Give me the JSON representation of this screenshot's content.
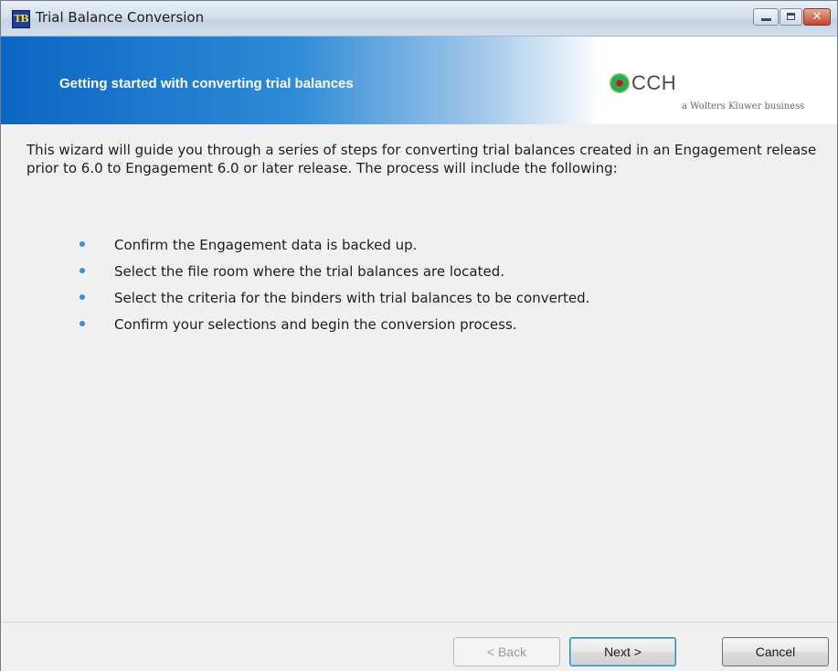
{
  "window": {
    "title": "Trial Balance Conversion",
    "icon": "TB-app-icon"
  },
  "titlebar_buttons": {
    "minimize_icon": "minimize-icon",
    "maximize_icon": "maximize-icon",
    "close_glyph": "✕"
  },
  "banner": {
    "title": "Getting started with converting trial balances",
    "logo_text": "CCH",
    "logo_sub": "a Wolters Kluwer business"
  },
  "content": {
    "intro": "This wizard will guide you through a series of steps for converting  trial balances created in an Engagement release prior to 6.0 to Engagement 6.0 or later release. The process will include the following:",
    "steps": [
      "Confirm the Engagement data is backed up.",
      "Select the file room where the trial balances are located.",
      "Select the criteria for the binders with trial balances to be converted.",
      "Confirm your selections and begin the conversion process."
    ]
  },
  "footer": {
    "back_label": "< Back",
    "next_label": "Next >",
    "cancel_label": "Cancel"
  },
  "colors": {
    "banner_blue": "#0a66c3",
    "bullet_blue": "#3d8fd6",
    "close_red": "#c3452a"
  }
}
